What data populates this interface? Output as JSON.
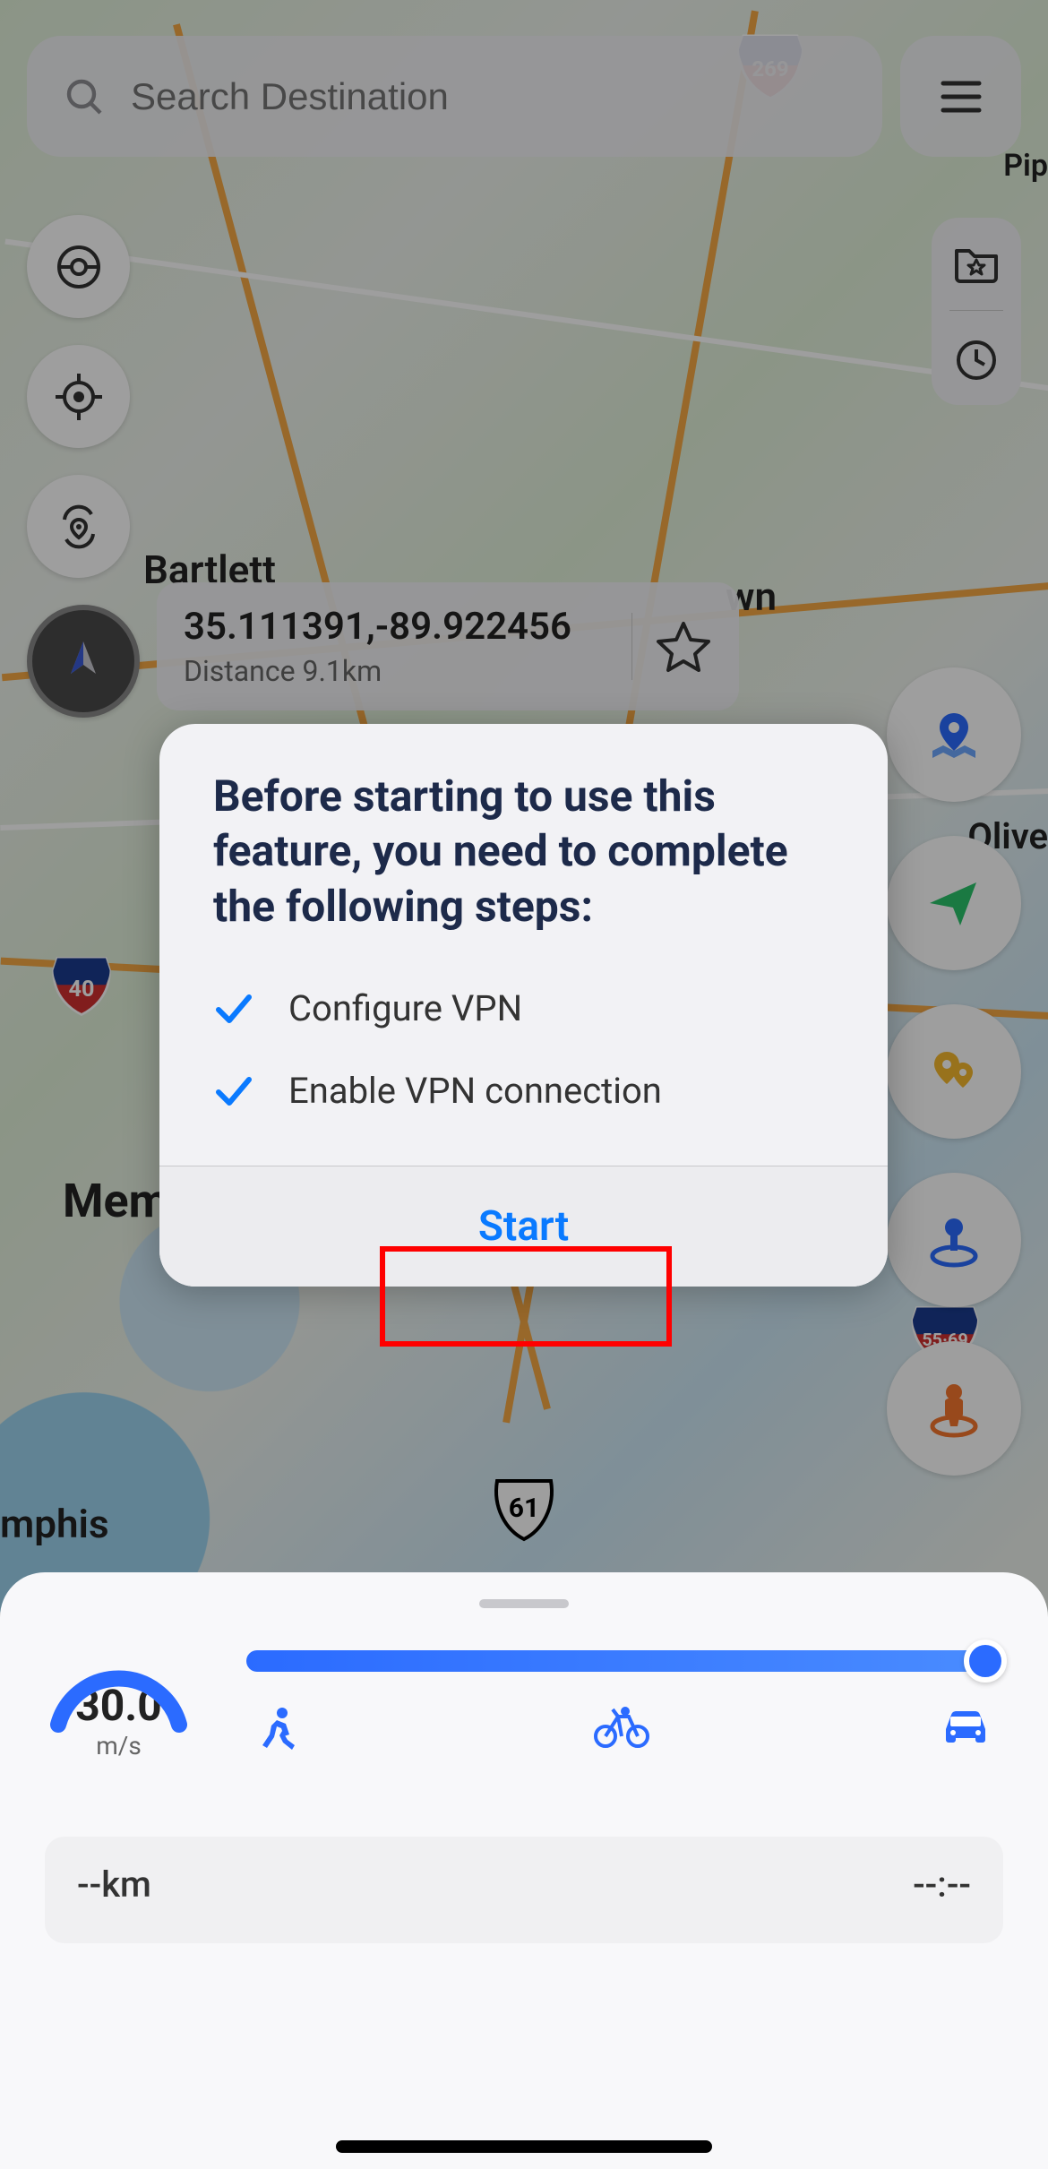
{
  "search": {
    "placeholder": "Search Destination"
  },
  "map_labels": {
    "bartlett": "Bartlett",
    "town_suffix": "wn",
    "olive": "Olive",
    "memphis_left": "Mem",
    "memphis_bottom": "mphis",
    "pip": "Pip"
  },
  "info": {
    "coords": "35.111391,-89.922456",
    "distance": "Distance 9.1km"
  },
  "modal": {
    "title": "Before starting to use this feature, you need to complete the following steps:",
    "step1": "Configure VPN",
    "step2": "Enable VPN connection",
    "start": "Start"
  },
  "speed": {
    "value": "30.0",
    "unit": "m/s"
  },
  "trip": {
    "distance": "--km",
    "time": "--:--"
  },
  "shield1": "269",
  "shield2": "40",
  "shield3": "55·69",
  "shield4": "61"
}
